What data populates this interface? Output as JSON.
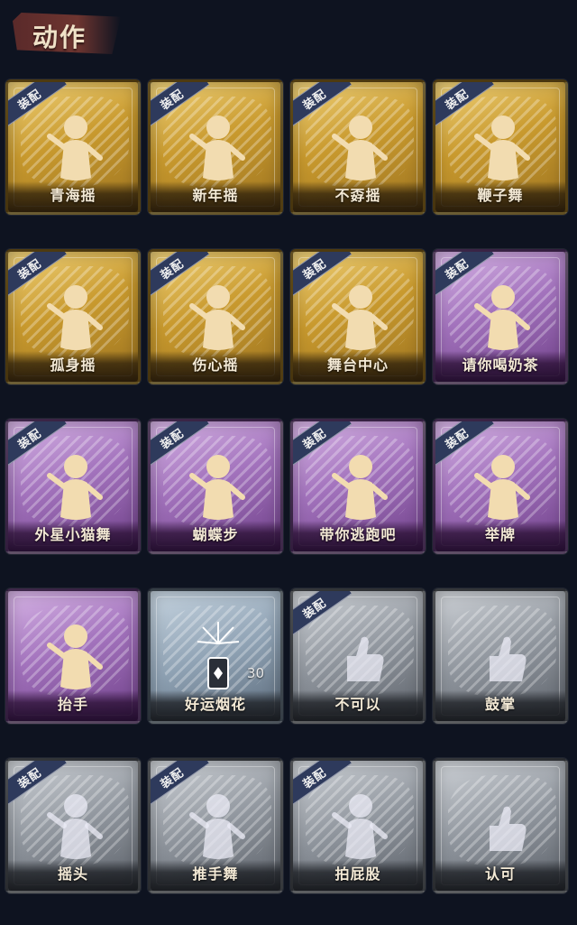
{
  "header": {
    "title": "动作"
  },
  "equip_label": "装配",
  "cards": [
    {
      "name": "青海摇",
      "tier": "gold",
      "equipped": true,
      "icon": "dance-pose-icon"
    },
    {
      "name": "新年摇",
      "tier": "gold",
      "equipped": true,
      "icon": "dance-pose-icon"
    },
    {
      "name": "不孬摇",
      "tier": "gold",
      "equipped": true,
      "icon": "dance-pose-icon"
    },
    {
      "name": "鞭子舞",
      "tier": "gold",
      "equipped": true,
      "icon": "dance-pose-icon"
    },
    {
      "name": "孤身摇",
      "tier": "gold",
      "equipped": true,
      "icon": "dance-pose-icon"
    },
    {
      "name": "伤心摇",
      "tier": "gold",
      "equipped": true,
      "icon": "heart-hands-icon"
    },
    {
      "name": "舞台中心",
      "tier": "gold",
      "equipped": true,
      "icon": "dance-pose-icon"
    },
    {
      "name": "请你喝奶茶",
      "tier": "purple",
      "equipped": true,
      "icon": "milk-tea-icon"
    },
    {
      "name": "外星小猫舞",
      "tier": "purple",
      "equipped": true,
      "icon": "dance-pose-icon"
    },
    {
      "name": "蝴蝶步",
      "tier": "purple",
      "equipped": true,
      "icon": "dance-pose-icon"
    },
    {
      "name": "带你逃跑吧",
      "tier": "purple",
      "equipped": true,
      "icon": "dance-pose-icon"
    },
    {
      "name": "举牌",
      "tier": "purple",
      "equipped": true,
      "icon": "sign-board-icon"
    },
    {
      "name": "抬手",
      "tier": "purple",
      "equipped": false,
      "icon": "raise-hand-icon"
    },
    {
      "name": "好运烟花",
      "tier": "blue",
      "equipped": false,
      "icon": "firework-icon",
      "count": "30"
    },
    {
      "name": "不可以",
      "tier": "gray",
      "equipped": true,
      "icon": "finger-wag-icon"
    },
    {
      "name": "鼓掌",
      "tier": "gray",
      "equipped": false,
      "icon": "clap-icon"
    },
    {
      "name": "摇头",
      "tier": "gray",
      "equipped": true,
      "icon": "head-shake-icon"
    },
    {
      "name": "推手舞",
      "tier": "gray",
      "equipped": true,
      "icon": "push-hand-dance-icon"
    },
    {
      "name": "拍屁股",
      "tier": "gray",
      "equipped": true,
      "icon": "butt-slap-icon"
    },
    {
      "name": "认可",
      "tier": "gray",
      "equipped": false,
      "icon": "thumbs-up-icon"
    }
  ]
}
